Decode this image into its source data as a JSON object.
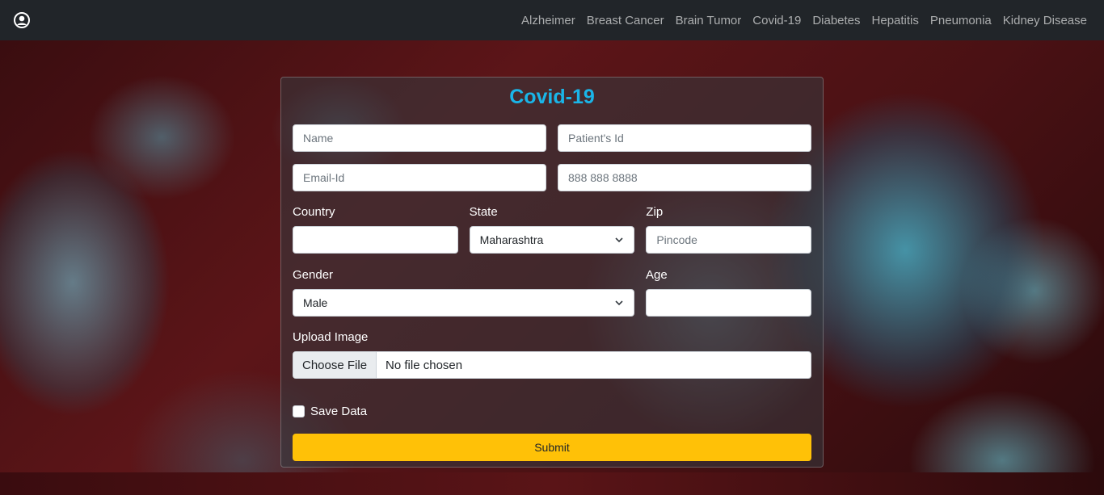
{
  "nav": {
    "links": [
      "Alzheimer",
      "Breast Cancer",
      "Brain Tumor",
      "Covid-19",
      "Diabetes",
      "Hepatitis",
      "Pneumonia",
      "Kidney Disease"
    ]
  },
  "form": {
    "title": "Covid-19",
    "name_placeholder": "Name",
    "patient_id_placeholder": "Patient's Id",
    "email_placeholder": "Email-Id",
    "phone_placeholder": "888 888 8888",
    "country_label": "Country",
    "country_value": "",
    "state_label": "State",
    "state_value": "Maharashtra",
    "zip_label": "Zip",
    "zip_placeholder": "Pincode",
    "gender_label": "Gender",
    "gender_value": "Male",
    "age_label": "Age",
    "age_value": "",
    "upload_label": "Upload Image",
    "choose_file": "Choose File",
    "no_file": "No file chosen",
    "save_label": "Save Data",
    "submit_label": "Submit"
  },
  "colors": {
    "navbar": "#212529",
    "title": "#1ab5e8",
    "submit": "#ffc107"
  }
}
